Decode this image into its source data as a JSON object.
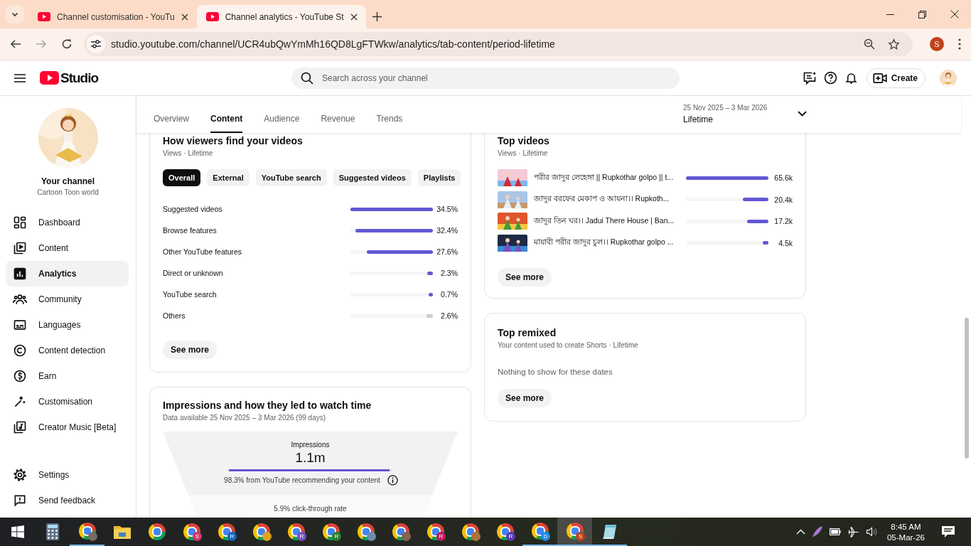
{
  "browser": {
    "tabs": [
      {
        "title": "Channel customisation - YouTu",
        "selected": false
      },
      {
        "title": "Channel analytics - YouTube St",
        "selected": true
      }
    ],
    "back_disabled": false,
    "forward_disabled": true,
    "url": "studio.youtube.com/channel/UCR4ubQwYmMh16QD8LgFTWkw/analytics/tab-content/period-lifetime",
    "profile_initial": "S"
  },
  "header": {
    "logo_text": "Studio",
    "search": {
      "placeholder": "Search across your channel"
    },
    "create_button": "Create"
  },
  "sidebar": {
    "channel_title": "Your channel",
    "channel_name": "Cartoon Toon world",
    "items": [
      {
        "label": "Dashboard",
        "kind": "dashboard",
        "selected": false
      },
      {
        "label": "Content",
        "kind": "content",
        "selected": false
      },
      {
        "label": "Analytics",
        "kind": "analytics",
        "selected": true
      },
      {
        "label": "Community",
        "kind": "community",
        "selected": false
      },
      {
        "label": "Languages",
        "kind": "languages",
        "selected": false
      },
      {
        "label": "Content detection",
        "kind": "copyright",
        "selected": false
      },
      {
        "label": "Earn",
        "kind": "earn",
        "selected": false
      },
      {
        "label": "Customisation",
        "kind": "customisation",
        "selected": false
      },
      {
        "label": "Creator Music [Beta]",
        "kind": "music",
        "selected": false
      }
    ],
    "footer_items": [
      {
        "label": "Settings",
        "kind": "settings"
      },
      {
        "label": "Send feedback",
        "kind": "feedback"
      }
    ]
  },
  "analytics_tabs": [
    {
      "label": "Overview",
      "selected": false
    },
    {
      "label": "Content",
      "selected": true
    },
    {
      "label": "Audience",
      "selected": false
    },
    {
      "label": "Revenue",
      "selected": false
    },
    {
      "label": "Trends",
      "selected": false
    }
  ],
  "date_range": {
    "range": "25 Nov 2025 – 3 Mar 2026",
    "period": "Lifetime"
  },
  "traffic_card": {
    "title": "How viewers find your videos",
    "subtitle": "Views · Lifetime",
    "filters": [
      {
        "label": "Overall",
        "selected": true
      },
      {
        "label": "External",
        "selected": false
      },
      {
        "label": "YouTube search",
        "selected": false
      },
      {
        "label": "Suggested videos",
        "selected": false
      },
      {
        "label": "Playlists",
        "selected": false
      }
    ],
    "sources": [
      {
        "name": "Suggested videos",
        "value": "34.5%",
        "level": 1,
        "color": "#6357d2"
      },
      {
        "name": "Browse features",
        "value": "32.4%",
        "level": 0.94,
        "color": "#6357d2"
      },
      {
        "name": "Other YouTube features",
        "value": "27.6%",
        "level": 0.8,
        "color": "#6357d2"
      },
      {
        "name": "Direct or unknown",
        "value": "2.3%",
        "level": 0.07,
        "color": "#6357d2"
      },
      {
        "name": "YouTube search",
        "value": "0.7%",
        "level": 0.05,
        "color": "#6357d2"
      },
      {
        "name": "Others",
        "value": "2.6%",
        "level": 0.08,
        "color": "#cccccc"
      }
    ],
    "see_more": "See more"
  },
  "impressions_card": {
    "title": "Impressions and how they led to watch time",
    "subtitle": "Data available 25 Nov 2025 – 3 Mar 2026 (99 days)",
    "impressions_label": "Impressions",
    "impressions_value": "1.1m",
    "level": 0.983,
    "recommend_note": "98.3% from YouTube recommending your content",
    "ctr": "5.9% click-through rate"
  },
  "top_videos": {
    "title": "Top videos",
    "subtitle": "Views · Lifetime",
    "videos": [
      {
        "title": "পরীর জাদুর লেহেঙ্গা || Rupkothar golpo || t...",
        "views": "65.6k",
        "level": 1
      },
      {
        "title": "জাদুর বরফের মেকাপ ও আয়না।। Rupkoth...",
        "views": "20.4k",
        "level": 0.31
      },
      {
        "title": "জাদুর তিন ঘর।। Jadui There House | Ban...",
        "views": "17.2k",
        "level": 0.26
      },
      {
        "title": "মায়াবী পরীর জাদুর চুল।। Rupkothar golpo ...",
        "views": "4.5k",
        "level": 0.07
      }
    ],
    "see_more": "See more"
  },
  "top_remixed": {
    "title": "Top remixed",
    "subtitle": "Your content used to create Shorts · Lifetime",
    "empty_text": "Nothing to show for these dates",
    "see_more": "See more"
  },
  "taskbar": {
    "apps": [
      {
        "kind": "calculator",
        "running": false,
        "selected": false
      },
      {
        "kind": "chrome",
        "color": "#7a6a62",
        "running": true,
        "selected": false
      },
      {
        "kind": "folder",
        "running": false,
        "selected": false
      },
      {
        "kind": "chrome",
        "running": false,
        "selected": false
      },
      {
        "kind": "chrome",
        "badge": "S",
        "color": "#d6336c",
        "running": false,
        "selected": false
      },
      {
        "kind": "chrome",
        "badge": "R",
        "color": "#1565c0",
        "running": false,
        "selected": false
      },
      {
        "kind": "chrome",
        "color": "#e0a020",
        "running": false,
        "selected": false
      },
      {
        "kind": "chrome",
        "badge": "R",
        "color": "#7b4fc0",
        "running": false,
        "selected": false
      },
      {
        "kind": "chrome",
        "badge": "R",
        "color": "#2e7d32",
        "running": false,
        "selected": false
      },
      {
        "kind": "chrome",
        "color": "#6d8cb0",
        "running": false,
        "selected": false
      },
      {
        "kind": "chrome",
        "color": "#8a6050",
        "running": false,
        "selected": false
      },
      {
        "kind": "chrome",
        "badge": "R",
        "color": "#c2185b",
        "running": false,
        "selected": false
      },
      {
        "kind": "chrome",
        "color": "#b0703a",
        "running": false,
        "selected": false
      },
      {
        "kind": "chrome",
        "badge": "R",
        "color": "#5e35b1",
        "running": false,
        "selected": false
      },
      {
        "kind": "chrome",
        "badge": "D",
        "color": "#1e88e5",
        "running": true,
        "selected": false
      },
      {
        "kind": "chrome",
        "badge": "S",
        "color": "#c1401a",
        "running": true,
        "selected": true
      },
      {
        "kind": "notepad",
        "running": true,
        "selected": false
      }
    ],
    "time": "8:45 AM",
    "date": "05-Mar-26"
  }
}
